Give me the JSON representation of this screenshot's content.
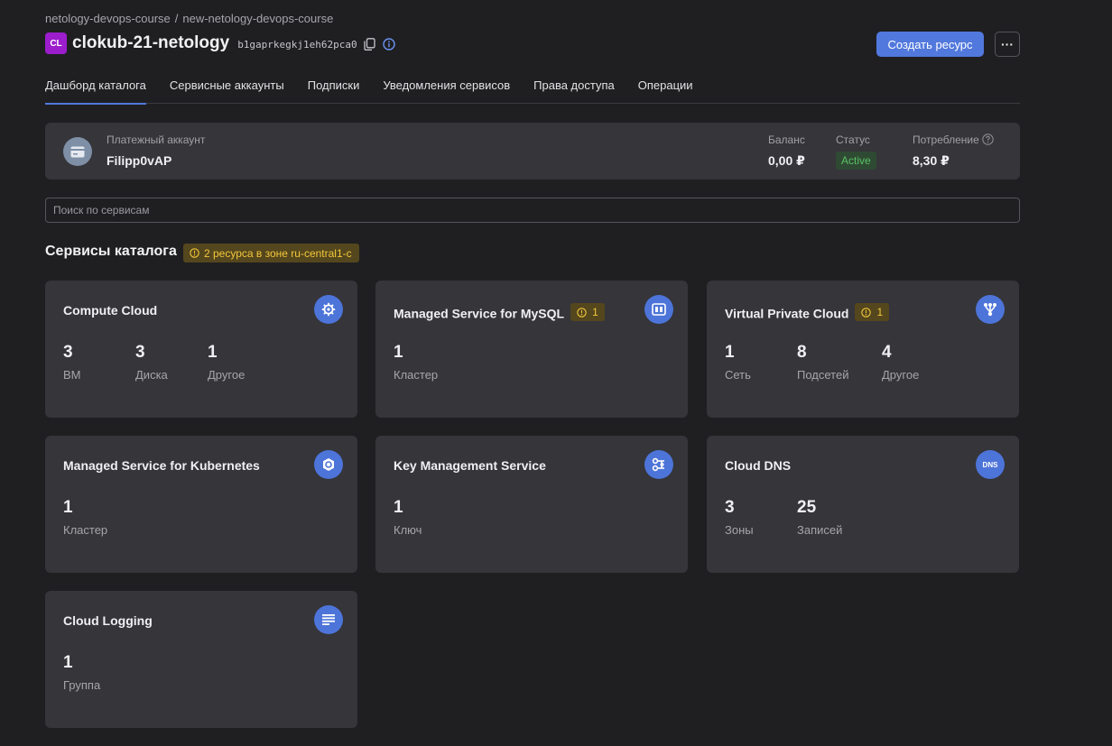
{
  "breadcrumb": {
    "cloud": "netology-devops-course",
    "separator": "/",
    "folder": "new-netology-devops-course"
  },
  "header": {
    "avatar": "CL",
    "title": "clokub-21-netology",
    "folder_id": "b1gaprkegkj1eh62pca0",
    "create_button": "Создать ресурс",
    "more_button": "···"
  },
  "tabs": [
    {
      "label": "Дашборд каталога",
      "active": true
    },
    {
      "label": "Сервисные аккаунты"
    },
    {
      "label": "Подписки"
    },
    {
      "label": "Уведомления сервисов"
    },
    {
      "label": "Права доступа"
    },
    {
      "label": "Операции"
    }
  ],
  "billing": {
    "label": "Платежный аккаунт",
    "name": "Filipp0vAP",
    "balance_label": "Баланс",
    "balance_value": "0,00 ₽",
    "status_label": "Статус",
    "status_value": "Active",
    "usage_label": "Потребление",
    "usage_value": "8,30 ₽"
  },
  "search": {
    "placeholder": "Поиск по сервисам"
  },
  "section": {
    "title": "Сервисы каталога",
    "warning": "2 ресурса в зоне ru-central1-c"
  },
  "colors": {
    "accent": "#5178dc",
    "warning": "#f3c73a",
    "success": "#59c165",
    "card": "#35353a"
  },
  "services": [
    {
      "title": "Compute Cloud",
      "icon": "compute-icon",
      "metrics": [
        {
          "value": "3",
          "label": "ВМ"
        },
        {
          "value": "3",
          "label": "Диска"
        },
        {
          "value": "1",
          "label": "Другое"
        }
      ]
    },
    {
      "title": "Managed Service for MySQL",
      "icon": "mysql-icon",
      "badge": "1",
      "metrics": [
        {
          "value": "1",
          "label": "Кластер"
        }
      ]
    },
    {
      "title": "Virtual Private Cloud",
      "icon": "network-icon",
      "badge": "1",
      "metrics": [
        {
          "value": "1",
          "label": "Сеть"
        },
        {
          "value": "8",
          "label": "Подсетей"
        },
        {
          "value": "4",
          "label": "Другое"
        }
      ]
    },
    {
      "title": "Managed Service for Kubernetes",
      "icon": "kubernetes-icon",
      "metrics": [
        {
          "value": "1",
          "label": "Кластер"
        }
      ]
    },
    {
      "title": "Key Management Service",
      "icon": "key-icon",
      "metrics": [
        {
          "value": "1",
          "label": "Ключ"
        }
      ]
    },
    {
      "title": "Cloud DNS",
      "icon": "dns-icon",
      "icon_text": "DNS",
      "metrics": [
        {
          "value": "3",
          "label": "Зоны"
        },
        {
          "value": "25",
          "label": "Записей"
        }
      ]
    },
    {
      "title": "Cloud Logging",
      "icon": "logging-icon",
      "metrics": [
        {
          "value": "1",
          "label": "Группа"
        }
      ]
    }
  ]
}
